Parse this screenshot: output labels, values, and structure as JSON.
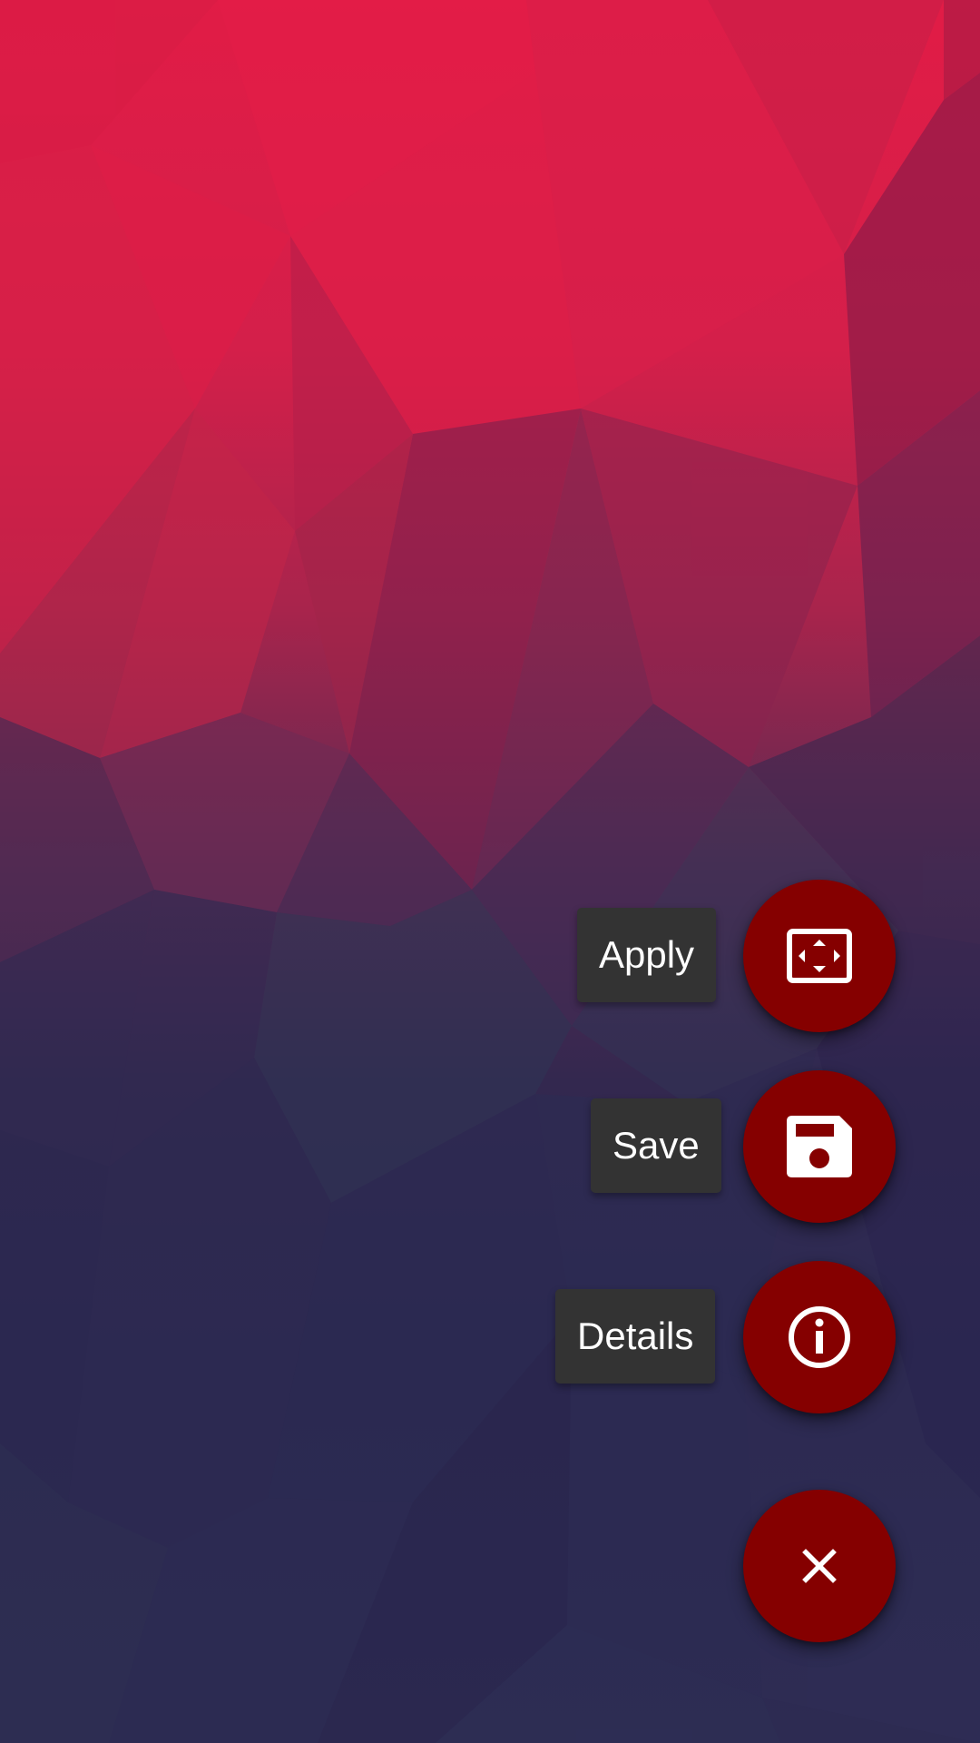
{
  "wallpaper": {
    "icon": "low-poly-wallpaper",
    "colors": {
      "top": "#e11c46",
      "bottom": "#2b2850"
    }
  },
  "speed_dial": {
    "actions": [
      {
        "label": "Apply",
        "icon": "fullscreen-icon"
      },
      {
        "label": "Save",
        "icon": "save-icon"
      },
      {
        "label": "Details",
        "icon": "info-icon"
      }
    ],
    "close_icon": "close-icon",
    "fab_color": "#850000",
    "label_background": "#333333"
  }
}
